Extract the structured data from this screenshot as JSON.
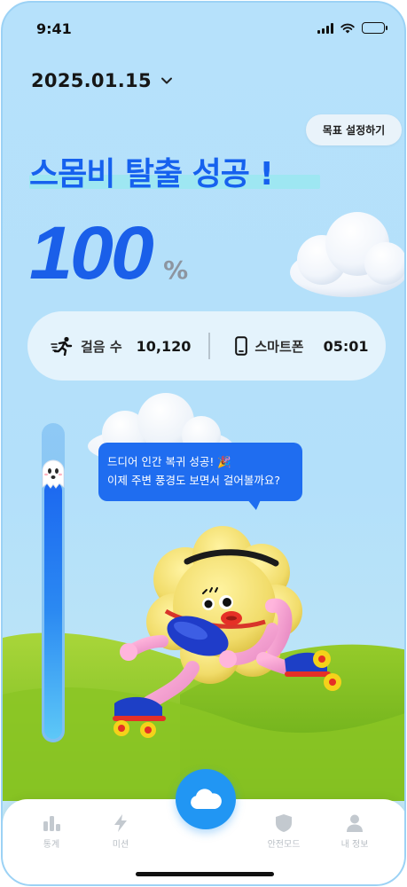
{
  "status_bar": {
    "time": "9:41"
  },
  "header": {
    "date": "2025.01.15",
    "goal_button": "목표 설정하기"
  },
  "result": {
    "title": "스몸비 탈출 성공 !",
    "percent_value": "100",
    "percent_unit": "%"
  },
  "stats": {
    "steps_label": "걸음 수",
    "steps_value": "10,120",
    "phone_label": "스마트폰",
    "phone_value": "05:01"
  },
  "progress": {
    "level": 1.0
  },
  "speech_bubble": {
    "line1": "드디어 인간 복귀 성공!",
    "line2": "이제 주변 풍경도 보면서 걸어볼까요?"
  },
  "bottom_nav": {
    "items": [
      {
        "label": "통계",
        "icon": "bar-chart-icon"
      },
      {
        "label": "미션",
        "icon": "lightning-icon"
      },
      {
        "label": "",
        "icon": "cloud-icon"
      },
      {
        "label": "안전모드",
        "icon": "shield-icon"
      },
      {
        "label": "내 정보",
        "icon": "person-icon"
      }
    ]
  },
  "colors": {
    "accent": "#1661ee",
    "sky": "#b6e1fb",
    "center_button": "#2196f3",
    "grass": "#7cc31f"
  }
}
